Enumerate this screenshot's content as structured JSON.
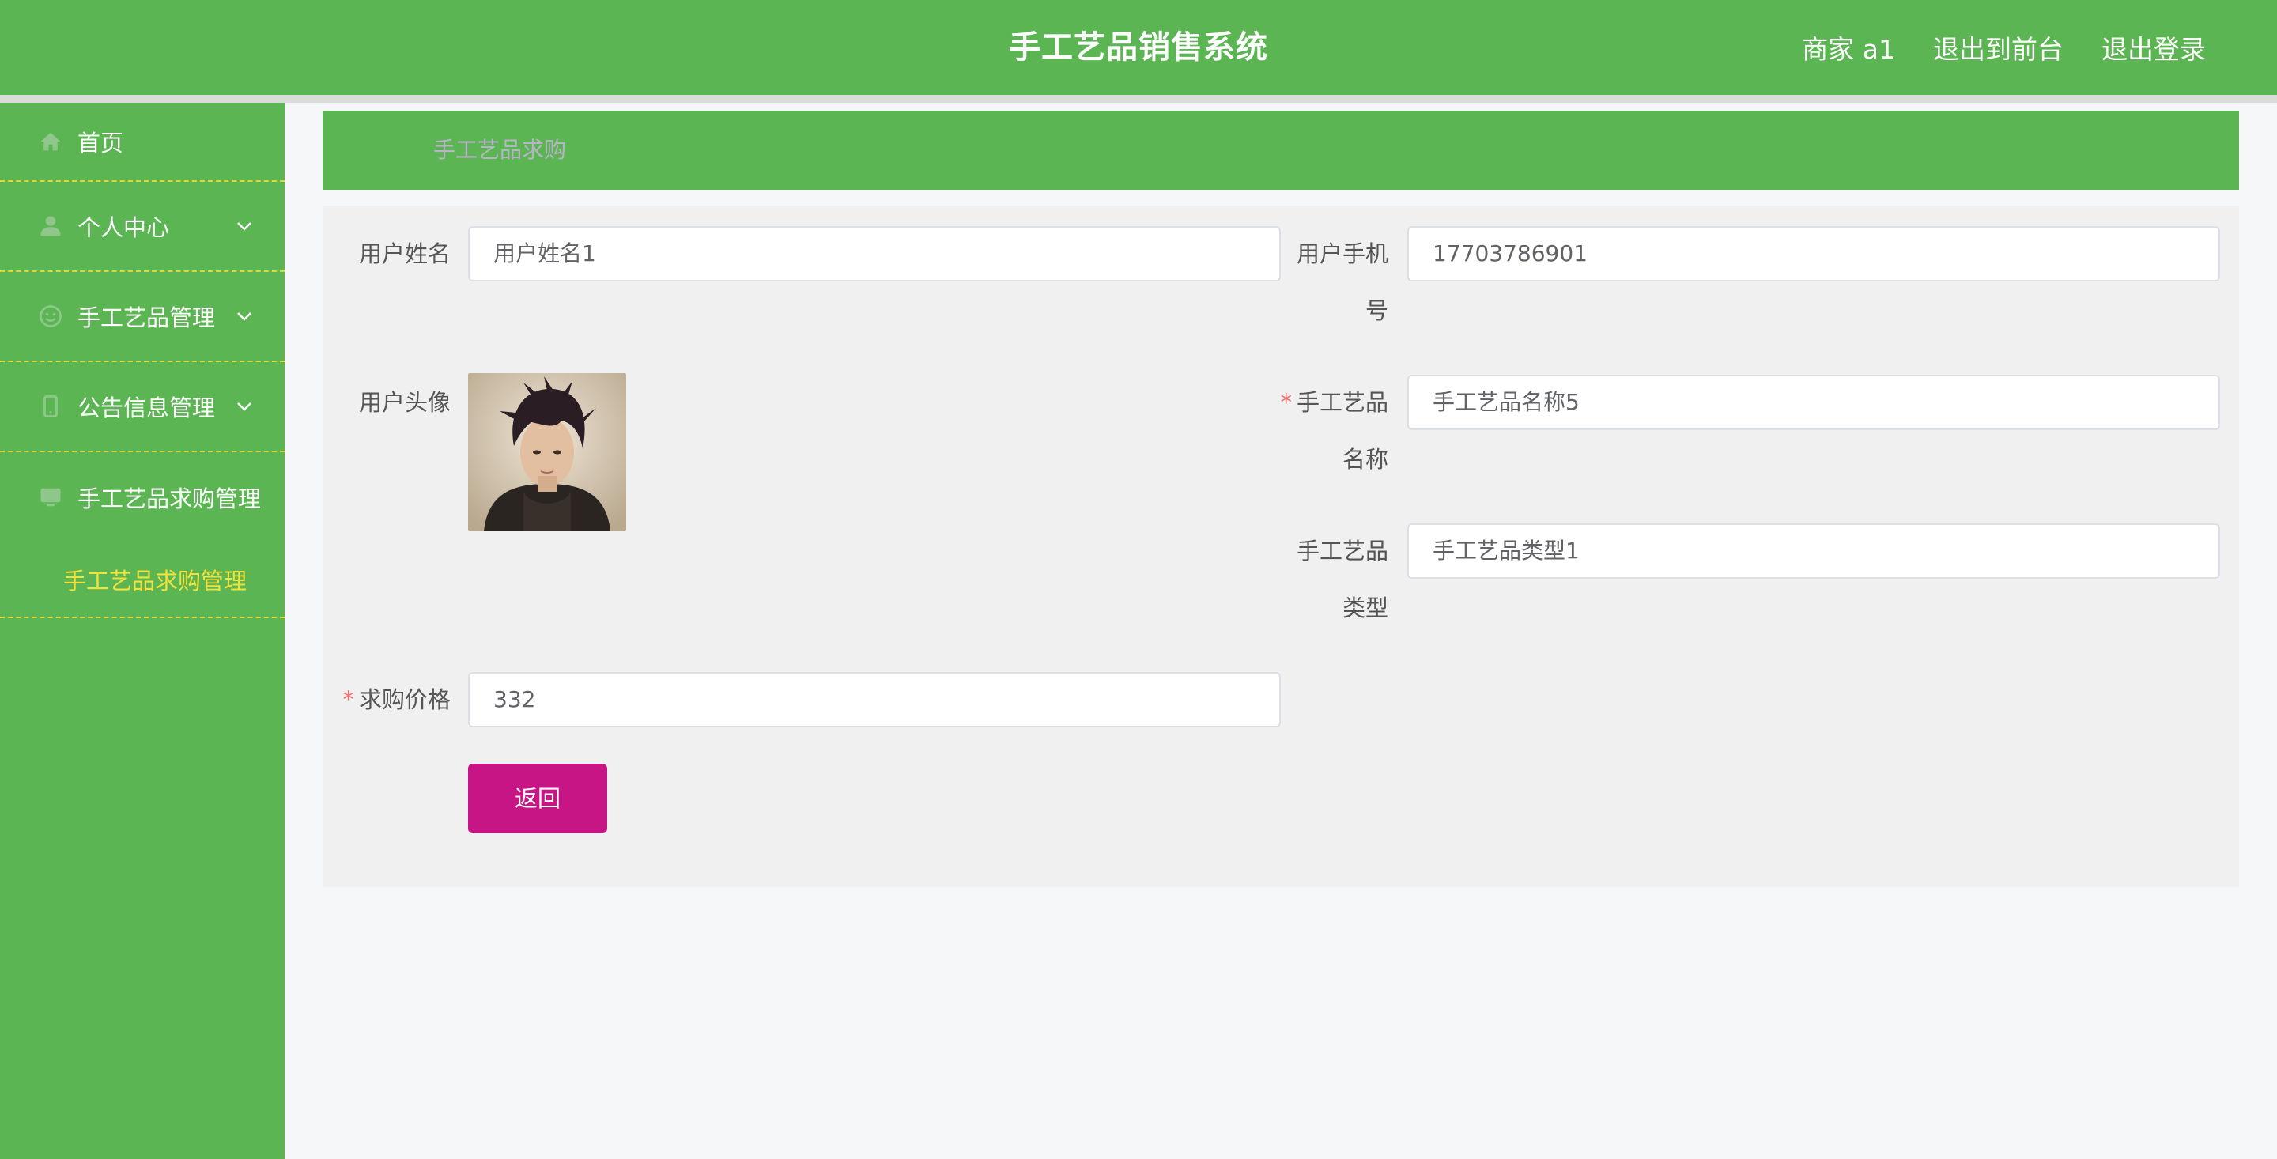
{
  "header": {
    "title": "手工艺品销售系统",
    "user": "商家 a1",
    "links": [
      "退出到前台",
      "退出登录"
    ]
  },
  "sidebar": {
    "items": [
      {
        "label": "首页",
        "icon": "home-icon"
      },
      {
        "label": "个人中心",
        "icon": "user-icon"
      },
      {
        "label": "手工艺品管理",
        "icon": "smile-icon"
      },
      {
        "label": "公告信息管理",
        "icon": "phone-icon"
      },
      {
        "label": "手工艺品求购管理",
        "icon": "monitor-icon"
      }
    ],
    "active_sub": "手工艺品求购管理"
  },
  "page": {
    "breadcrumb": "手工艺品求购"
  },
  "form": {
    "username": {
      "label": "用户姓名",
      "value": "用户姓名1"
    },
    "phone": {
      "label_line1": "用户手机",
      "label_line2": "号",
      "value": "17703786901"
    },
    "avatar": {
      "label": "用户头像"
    },
    "product_name": {
      "required": "*",
      "label_line1": "手工艺品",
      "label_line2": "名称",
      "value": "手工艺品名称5"
    },
    "product_type": {
      "label_line1": "手工艺品",
      "label_line2": "类型",
      "value": "手工艺品类型1"
    },
    "price": {
      "required": "*",
      "label": "求购价格",
      "value": "332"
    },
    "back_button": "返回"
  },
  "colors": {
    "primary_green": "#5ab552",
    "sidebar_divider": "#e0d63a",
    "active_submenu": "#f4e13a",
    "back_button": "#c71585",
    "required_mark": "#f56c6c"
  }
}
